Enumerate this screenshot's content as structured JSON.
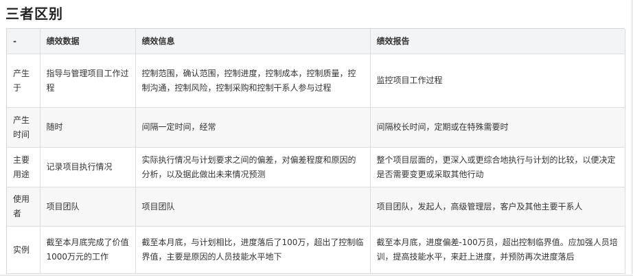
{
  "title": "三者区别",
  "table": {
    "headers": [
      "-",
      "绩效数据",
      "绩效信息",
      "绩效报告"
    ],
    "rows": [
      {
        "label": "产生于",
        "data": "指导与管理项目工作过程",
        "info": "控制范围，确认范围，控制进度，控制成本，控制质量，控制沟通，控制风险，控制采购和控制干系人参与过程",
        "report": "监控项目工作过程"
      },
      {
        "label": "产生时间",
        "data": "随时",
        "info": "间隔一定时间，经常",
        "report": "间隔校长时间，定期或在特殊需要时"
      },
      {
        "label": "主要用途",
        "data": "记录项目执行情况",
        "info": "实际执行情况与计划要求之间的偏差，对偏差程度和原因的分析，以及据此做出未来情况预测",
        "report": "整个项目层面的，更深入或更综合地执行与计划的比较，以便决定是否需要变更或采取其他行动"
      },
      {
        "label": "使用者",
        "data": "项目团队",
        "info": "项目团队",
        "report": "项目团队，发起人，高级管理层，客户及其他主要干系人"
      },
      {
        "label": "实例",
        "data": "截至本月底完成了价值1000万元的工作",
        "info": "截至本月底，与计划相比，进度落后了100万，超出了控制临界值，主要是原因的人员技能水平地下",
        "report": "截至本月底，进度偏差-100万员，超出控制临界值。应加强人员培训，提高技能水平，来赶上进度，并预防再次进度落后"
      }
    ]
  }
}
